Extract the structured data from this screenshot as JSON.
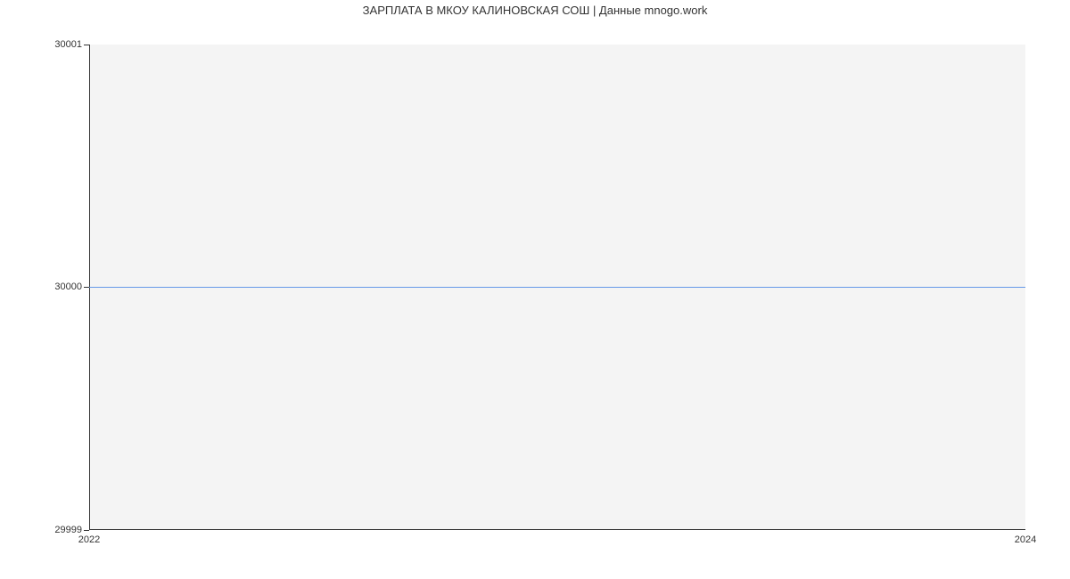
{
  "chart_data": {
    "type": "line",
    "title": "ЗАРПЛАТА В МКОУ КАЛИНОВСКАЯ СОШ | Данные mnogo.work",
    "xlabel": "",
    "ylabel": "",
    "x": [
      2022,
      2024
    ],
    "series": [
      {
        "name": "salary",
        "values": [
          30000,
          30000
        ],
        "color": "#6699e8"
      }
    ],
    "xlim": [
      2022,
      2024
    ],
    "ylim": [
      29999,
      30001
    ],
    "x_ticks": [
      2022,
      2024
    ],
    "y_ticks": [
      29999,
      30000,
      30001
    ]
  }
}
